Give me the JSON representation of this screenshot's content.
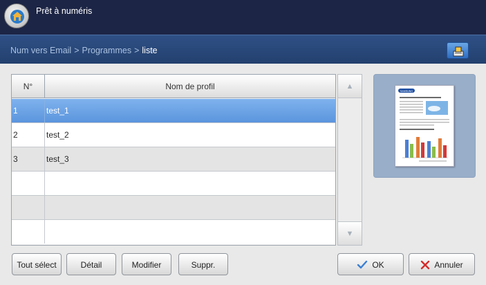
{
  "header": {
    "title": "Prêt à numéris",
    "home_icon": "home-icon"
  },
  "breadcrumb": {
    "items": [
      "Num vers Email",
      "Programmes",
      "liste"
    ],
    "separator": ">",
    "tray_icon": "tray-icon"
  },
  "table": {
    "columns": [
      "N°",
      "Nom de profil"
    ],
    "rows": [
      {
        "no": "1",
        "name": "test_1",
        "selected": true
      },
      {
        "no": "2",
        "name": "test_2",
        "selected": false
      },
      {
        "no": "3",
        "name": "test_3",
        "selected": false
      },
      {
        "no": "",
        "name": "",
        "selected": false
      },
      {
        "no": "",
        "name": "",
        "selected": false
      },
      {
        "no": "",
        "name": "",
        "selected": false
      }
    ]
  },
  "scrollbar": {
    "up_icon": "scroll-up-icon",
    "down_icon": "scroll-down-icon"
  },
  "preview": {
    "brand": "SAMSUNG"
  },
  "actions": {
    "select_all": "Tout sélect",
    "detail": "Détail",
    "modify": "Modifier",
    "delete": "Suppr.",
    "ok": "OK",
    "cancel": "Annuler"
  },
  "colors": {
    "top_bar": "#1c2545",
    "breadcrumb_bar": "#2f5086",
    "selected_row": "#6aa3e6",
    "ok_check": "#3b7fd6",
    "cancel_x": "#d62b2b"
  }
}
